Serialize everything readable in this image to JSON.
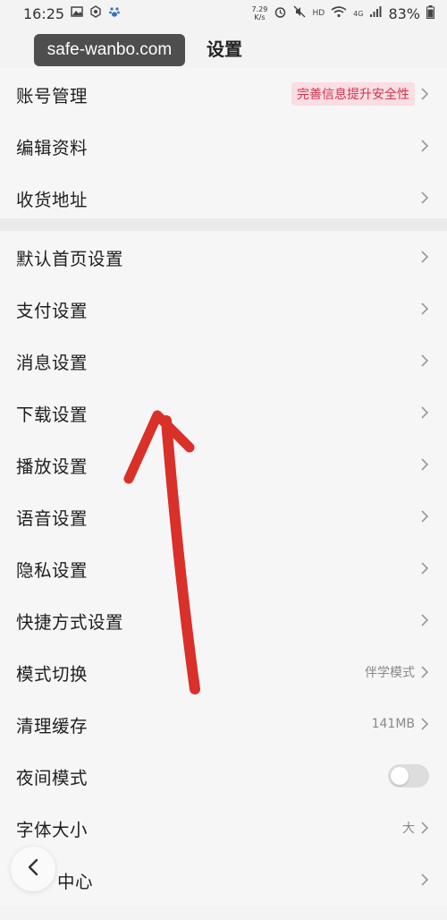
{
  "status_bar": {
    "time": "16:25",
    "net_speed_value": "7.29",
    "net_speed_unit": "K/s",
    "hd": "HD",
    "network": "4G",
    "battery": "83%"
  },
  "watermark": "safe-wanbo.com",
  "header": {
    "title": "设置"
  },
  "group1": [
    {
      "label": "账号管理",
      "badge": "完善信息提升安全性"
    },
    {
      "label": "编辑资料"
    },
    {
      "label": "收货地址"
    }
  ],
  "group2": [
    {
      "label": "默认首页设置"
    },
    {
      "label": "支付设置"
    },
    {
      "label": "消息设置"
    },
    {
      "label": "下载设置"
    },
    {
      "label": "播放设置"
    },
    {
      "label": "语音设置"
    },
    {
      "label": "隐私设置"
    },
    {
      "label": "快捷方式设置"
    },
    {
      "label": "模式切换",
      "value": "伴学模式"
    },
    {
      "label": "清理缓存",
      "value": "141MB"
    },
    {
      "label": "夜间模式",
      "toggle": false
    },
    {
      "label": "字体大小",
      "value": "大"
    },
    {
      "label": "中心"
    }
  ],
  "colors": {
    "annotation_arrow": "#d9302a",
    "badge_text": "#d0334f",
    "badge_bg": "#fbdde3"
  }
}
